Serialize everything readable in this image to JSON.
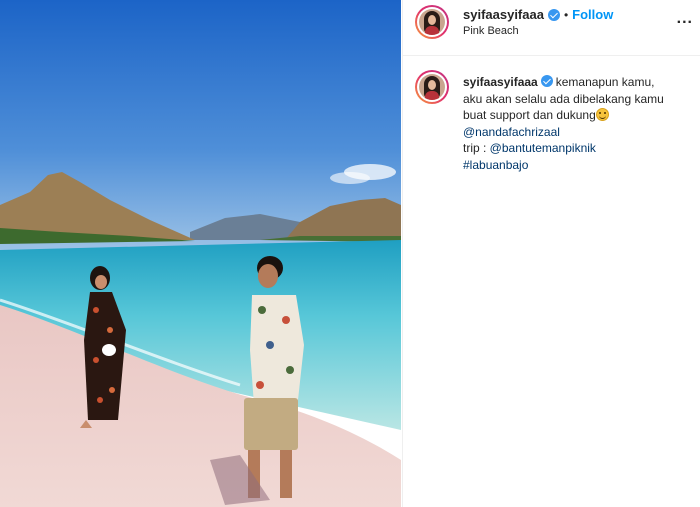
{
  "post": {
    "username": "syifaasyifaaa",
    "verified": true,
    "separator": "•",
    "follow_label": "Follow",
    "location": "Pink Beach",
    "more_label": "...",
    "photo_alt": "photo",
    "caption": {
      "username": "syifaasyifaaa",
      "line1": "kemanapun kamu,",
      "line2": "aku akan selalu ada dibelakang kamu",
      "line3": "buat support dan dukung",
      "mention": "@nandafachrizaal",
      "trip_label": "trip : ",
      "trip_mention": "@bantutemanpiknik",
      "hashtag": "#labuanbajo"
    }
  },
  "colors": {
    "link": "#00376b",
    "follow": "#0095f6",
    "verified": "#3897f0"
  },
  "icons": {
    "verified": "verified-badge-icon",
    "more": "more-options-icon",
    "emoji": "grinning-face-emoji"
  }
}
